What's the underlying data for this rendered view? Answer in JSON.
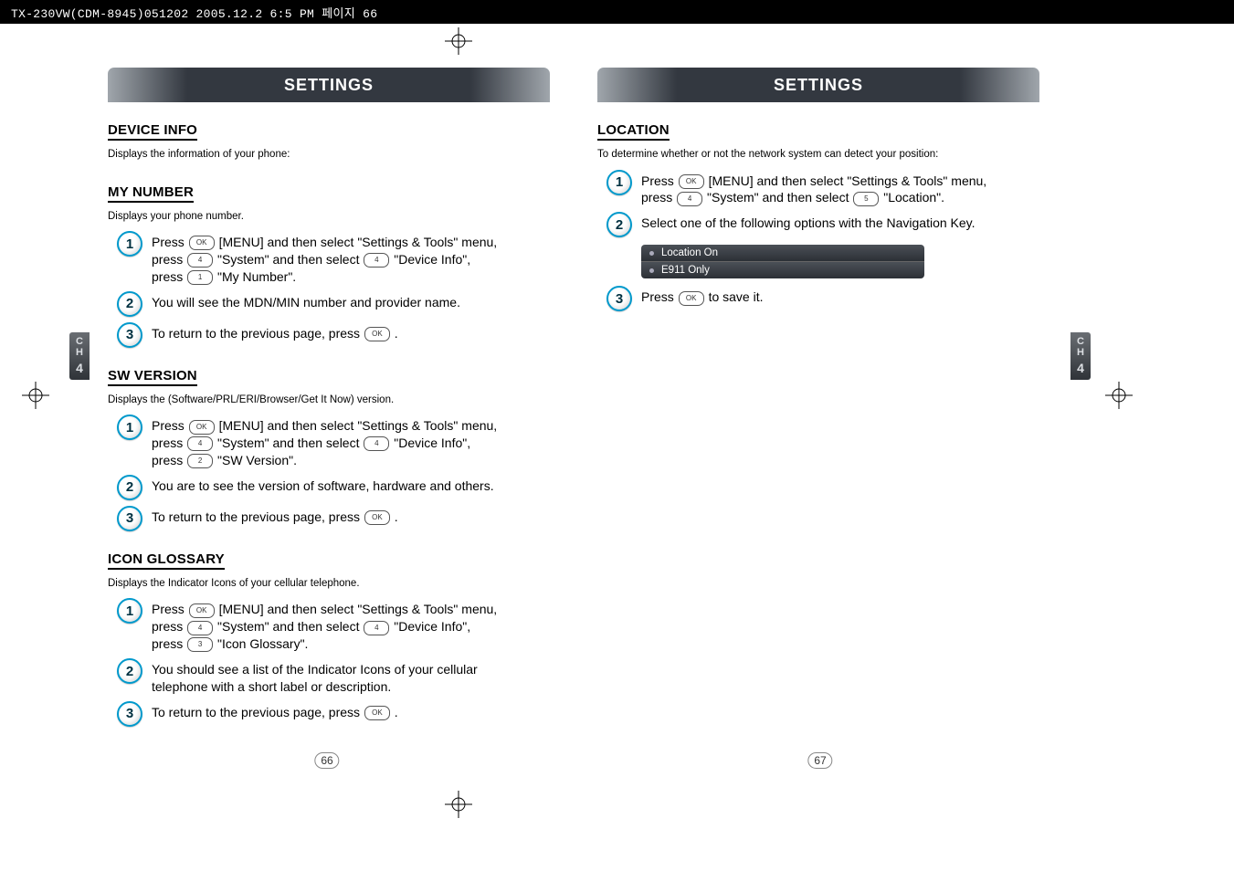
{
  "print_header": "TX-230VW(CDM-8945)051202  2005.12.2 6:5 PM  페이지 66",
  "chapter_tab": {
    "label_line1": "C",
    "label_line2": "H",
    "number": "4"
  },
  "left": {
    "band_title": "SETTINGS",
    "page_number": "66",
    "sections": [
      {
        "heading": "DEVICE INFO",
        "desc": "Displays the information of your phone:",
        "steps": []
      },
      {
        "heading": "MY NUMBER",
        "desc": "Displays your phone number.",
        "steps": [
          {
            "n": "1",
            "pre": "Press ",
            "k1": "OK",
            "mid1": " [MENU] and then select \"Settings & Tools\" menu, press ",
            "k2": "4",
            "mid2": " \"System\" and then select ",
            "k3": "4",
            "mid3": " \"Device Info\", press ",
            "k4": "1",
            "post": " \"My Number\"."
          },
          {
            "n": "2",
            "plain": "You will see the MDN/MIN number and provider name."
          },
          {
            "n": "3",
            "pre": "To return to the previous page, press ",
            "k1": "OK",
            "post": " ."
          }
        ]
      },
      {
        "heading": "SW VERSION",
        "desc": "Displays the (Software/PRL/ERI/Browser/Get It Now) version.",
        "steps": [
          {
            "n": "1",
            "pre": "Press ",
            "k1": "OK",
            "mid1": " [MENU] and then select \"Settings & Tools\" menu, press ",
            "k2": "4",
            "mid2": " \"System\" and then select ",
            "k3": "4",
            "mid3": " \"Device Info\", press ",
            "k4": "2",
            "post": " \"SW Version\"."
          },
          {
            "n": "2",
            "plain": "You are to see the version of software, hardware and others."
          },
          {
            "n": "3",
            "pre": "To return to the previous page, press ",
            "k1": "OK",
            "post": " ."
          }
        ]
      },
      {
        "heading": "ICON GLOSSARY",
        "desc": "Displays the Indicator Icons of your cellular telephone.",
        "steps": [
          {
            "n": "1",
            "pre": "Press ",
            "k1": "OK",
            "mid1": " [MENU] and then select \"Settings & Tools\" menu, press ",
            "k2": "4",
            "mid2": " \"System\" and then select ",
            "k3": "4",
            "mid3": " \"Device Info\", press ",
            "k4": "3",
            "post": " \"Icon Glossary\"."
          },
          {
            "n": "2",
            "plain": "You should see a list of the Indicator Icons of your cellular telephone with a short label or description."
          },
          {
            "n": "3",
            "pre": "To return to the previous page, press ",
            "k1": "OK",
            "post": " ."
          }
        ]
      }
    ]
  },
  "right": {
    "band_title": "SETTINGS",
    "page_number": "67",
    "sections": [
      {
        "heading": "LOCATION",
        "desc": "To determine whether or not the network system can detect your position:",
        "steps": [
          {
            "n": "1",
            "pre": "Press ",
            "k1": "OK",
            "mid1": " [MENU] and then select \"Settings & Tools\" menu, press ",
            "k2": "4",
            "mid2": " \"System\" and then select ",
            "k3": "5",
            "post": " \"Location\"."
          },
          {
            "n": "2",
            "plain": "Select one of the following options with the Navigation Key.",
            "options": [
              "Location On",
              "E911 Only"
            ]
          },
          {
            "n": "3",
            "pre": "Press ",
            "k1": "OK",
            "post": " to save it."
          }
        ]
      }
    ]
  }
}
